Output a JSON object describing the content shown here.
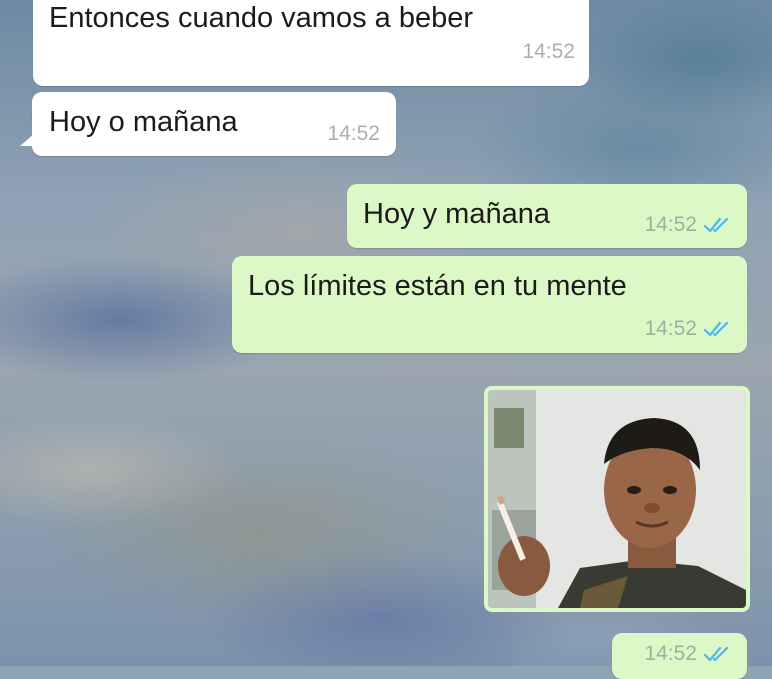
{
  "colors": {
    "incoming_bubble": "#ffffff",
    "outgoing_bubble": "#dcf8c6",
    "read_ticks": "#4fb6ec"
  },
  "messages": [
    {
      "direction": "incoming",
      "text": "Entonces cuando vamos a beber",
      "time": "14:52"
    },
    {
      "direction": "incoming",
      "text": "Hoy o mañana",
      "time": "14:52"
    },
    {
      "direction": "outgoing",
      "text": "Hoy y mañana",
      "time": "14:52",
      "status": "read"
    },
    {
      "direction": "outgoing",
      "text": "Los límites están en tu mente",
      "time": "14:52",
      "status": "read"
    },
    {
      "direction": "outgoing",
      "type": "image",
      "image_icon": "photo-child-cigarette",
      "time": "14:52",
      "status": "read"
    }
  ]
}
